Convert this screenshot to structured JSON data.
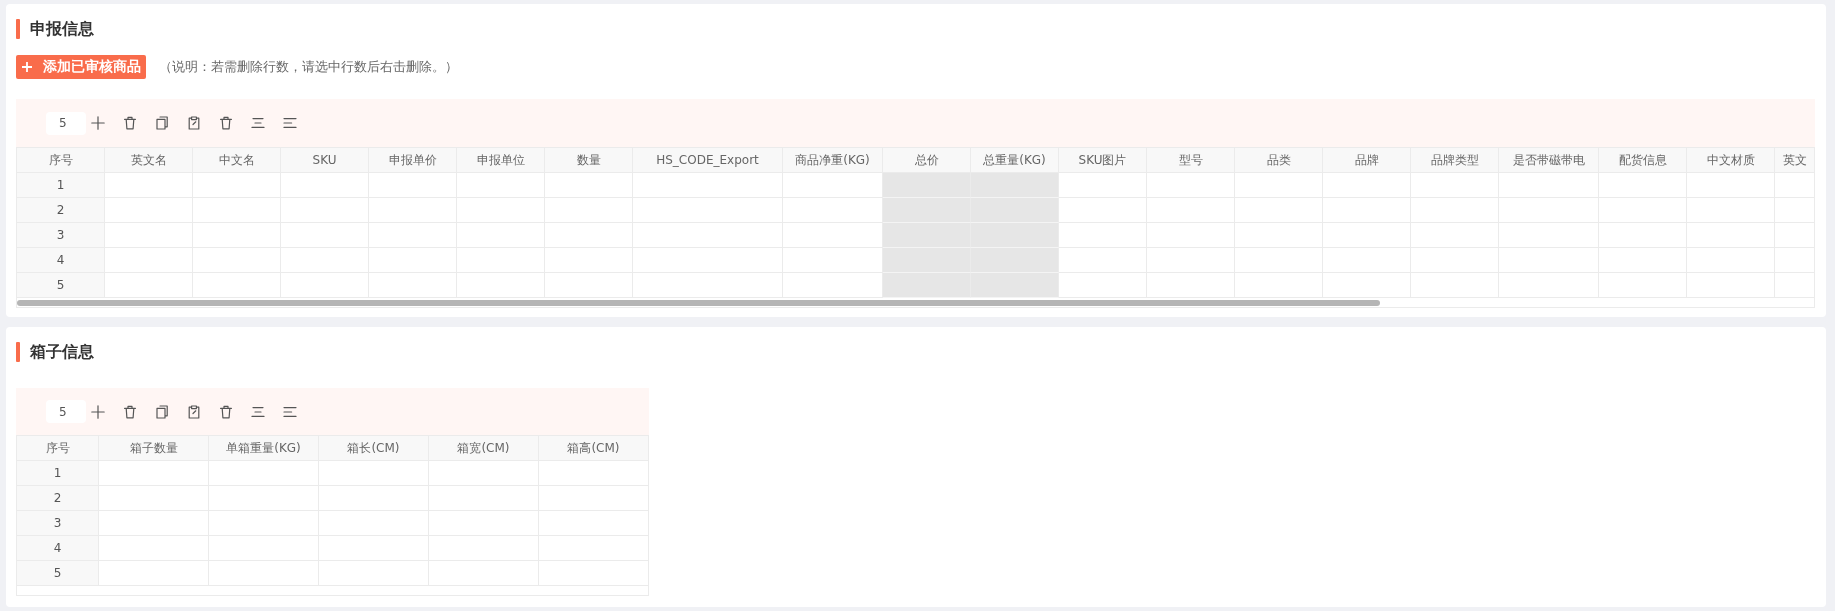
{
  "sections": [
    {
      "title": "申报信息",
      "add_button": {
        "label": "添加已审核商品"
      },
      "note": "（说明：若需删除行数，请选中行数后右击删除。）",
      "row_count_input": {
        "value": "5"
      },
      "table": {
        "index_header": "序号",
        "columns": [
          {
            "label": "英文名",
            "readonly": false
          },
          {
            "label": "中文名",
            "readonly": false
          },
          {
            "label": "SKU",
            "readonly": false
          },
          {
            "label": "申报单价",
            "readonly": false
          },
          {
            "label": "申报单位",
            "readonly": false
          },
          {
            "label": "数量",
            "readonly": false
          },
          {
            "label": "HS_CODE_Export",
            "readonly": false
          },
          {
            "label": "商品净重(KG)",
            "readonly": false
          },
          {
            "label": "总价",
            "readonly": true
          },
          {
            "label": "总重量(KG)",
            "readonly": true
          },
          {
            "label": "SKU图片",
            "readonly": false
          },
          {
            "label": "型号",
            "readonly": false
          },
          {
            "label": "品类",
            "readonly": false
          },
          {
            "label": "品牌",
            "readonly": false
          },
          {
            "label": "品牌类型",
            "readonly": false
          },
          {
            "label": "是否带磁带电",
            "readonly": false
          },
          {
            "label": "配货信息",
            "readonly": false
          },
          {
            "label": "中文材质",
            "readonly": false
          },
          {
            "label": "英文",
            "readonly": false
          }
        ],
        "rows": [
          {
            "number": "1"
          },
          {
            "number": "2"
          },
          {
            "number": "3"
          },
          {
            "number": "4"
          },
          {
            "number": "5"
          }
        ]
      }
    },
    {
      "title": "箱子信息",
      "row_count_input": {
        "value": "5"
      },
      "table": {
        "index_header": "序号",
        "columns": [
          {
            "label": "箱子数量",
            "readonly": false
          },
          {
            "label": "单箱重量(KG)",
            "readonly": false
          },
          {
            "label": "箱长(CM)",
            "readonly": false
          },
          {
            "label": "箱宽(CM)",
            "readonly": false
          },
          {
            "label": "箱高(CM)",
            "readonly": false
          }
        ],
        "rows": [
          {
            "number": "1"
          },
          {
            "number": "2"
          },
          {
            "number": "3"
          },
          {
            "number": "4"
          },
          {
            "number": "5"
          }
        ]
      }
    }
  ]
}
